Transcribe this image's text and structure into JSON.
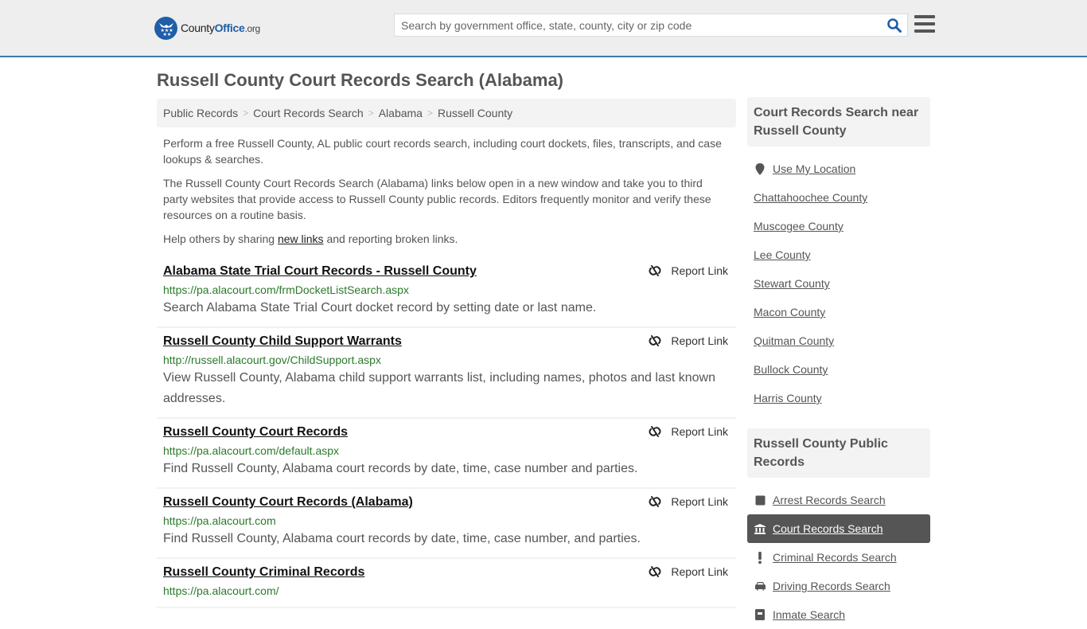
{
  "header": {
    "logo": {
      "name": "County",
      "office": "Office",
      "tld": ".org"
    },
    "search_placeholder": "Search by government office, state, county, city or zip code",
    "search_value": ""
  },
  "page_title": "Russell County Court Records Search (Alabama)",
  "breadcrumb": [
    "Public Records",
    "Court Records Search",
    "Alabama",
    "Russell County"
  ],
  "intro": {
    "p1": "Perform a free Russell County, AL public court records search, including court dockets, files, transcripts, and case lookups & searches.",
    "p2": "The Russell County Court Records Search (Alabama) links below open in a new window and take you to third party websites that provide access to Russell County public records. Editors frequently monitor and verify these resources on a routine basis.",
    "p3_before": "Help others by sharing ",
    "p3_link": "new links",
    "p3_after": " and reporting broken links."
  },
  "report_label": "Report Link",
  "results": [
    {
      "title": "Alabama State Trial Court Records - Russell County",
      "url": "https://pa.alacourt.com/frmDocketListSearch.aspx",
      "desc": "Search Alabama State Trial Court docket record by setting date or last name."
    },
    {
      "title": "Russell County Child Support Warrants",
      "url": "http://russell.alacourt.gov/ChildSupport.aspx",
      "desc": "View Russell County, Alabama child support warrants list, including names, photos and last known addresses."
    },
    {
      "title": "Russell County Court Records",
      "url": "https://pa.alacourt.com/default.aspx",
      "desc": "Find Russell County, Alabama court records by date, time, case number and parties."
    },
    {
      "title": "Russell County Court Records (Alabama)",
      "url": "https://pa.alacourt.com",
      "desc": "Find Russell County, Alabama court records by date, time, case number, and parties."
    },
    {
      "title": "Russell County Criminal Records",
      "url": "https://pa.alacourt.com/",
      "desc": ""
    }
  ],
  "sidebar": {
    "nearby_heading": "Court Records Search near Russell County",
    "use_location": "Use My Location",
    "nearby": [
      "Chattahoochee County",
      "Muscogee County",
      "Lee County",
      "Stewart County",
      "Macon County",
      "Quitman County",
      "Bullock County",
      "Harris County"
    ],
    "public_heading": "Russell County Public Records",
    "public_records": [
      {
        "label": "Arrest Records Search",
        "icon": "square-icon",
        "active": false
      },
      {
        "label": "Court Records Search",
        "icon": "courthouse-icon",
        "active": true
      },
      {
        "label": "Criminal Records Search",
        "icon": "exclamation-icon",
        "active": false
      },
      {
        "label": "Driving Records Search",
        "icon": "car-icon",
        "active": false
      },
      {
        "label": "Inmate Search",
        "icon": "inmate-icon",
        "active": false
      }
    ]
  },
  "colors": {
    "accent": "#3a7bab",
    "brand": "#1f5ea8",
    "url_green": "#2a7a2a",
    "active_bg": "#555555"
  }
}
